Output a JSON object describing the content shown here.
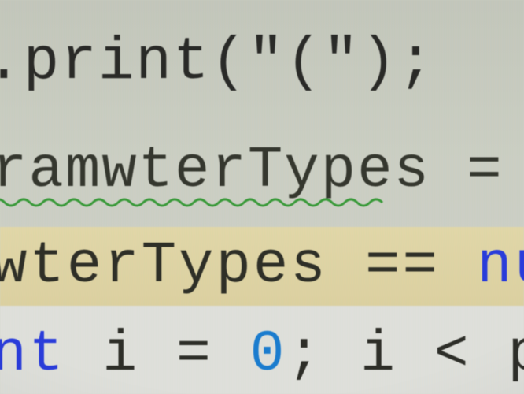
{
  "editor": {
    "lines": [
      {
        "tokens": [
          {
            "kind": "default",
            "text": ".print(\"(\");"
          }
        ]
      },
      {
        "tokens": [
          {
            "kind": "default",
            "text": "ramwterTypes = m."
          }
        ],
        "typo_squiggle": true
      },
      {
        "highlighted": true,
        "tokens": [
          {
            "kind": "default",
            "text": "wterTypes == "
          },
          {
            "kind": "keyword",
            "text": "null"
          }
        ]
      },
      {
        "tokens": [
          {
            "kind": "keyword",
            "text": "nt"
          },
          {
            "kind": "default",
            "text": " i = "
          },
          {
            "kind": "number",
            "text": "0"
          },
          {
            "kind": "default",
            "text": "; i < par"
          }
        ]
      }
    ]
  },
  "colors": {
    "background": "#cfd2c7",
    "highlight": "#e6dba6",
    "text": "#2e2f29",
    "keyword": "#2a3de0",
    "number": "#1b7fd4",
    "squiggle": "#3a9d3a"
  }
}
